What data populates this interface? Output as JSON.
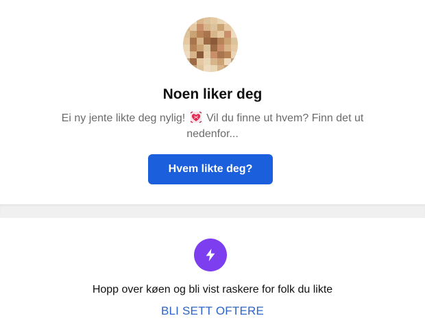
{
  "like_card": {
    "avatar_icon": "blurred-profile-photo",
    "title": "Noen liker deg",
    "subtitle_part1": "Ei ny jente likte deg nylig!",
    "subtitle_emoji": "heart-with-ribbon-emoji",
    "subtitle_part2": "Vil du finne ut hvem? Finn det ut nedenfor...",
    "button_label": "Hvem likte deg?",
    "button_color": "#1b5fdd"
  },
  "boost_card": {
    "icon": "lightning-bolt-icon",
    "icon_color": "#7d3ef0",
    "text": "Hopp over køen og bli vist raskere for folk du likte",
    "link_label": "BLI SETT OFTERE",
    "link_color": "#2a63c9"
  }
}
